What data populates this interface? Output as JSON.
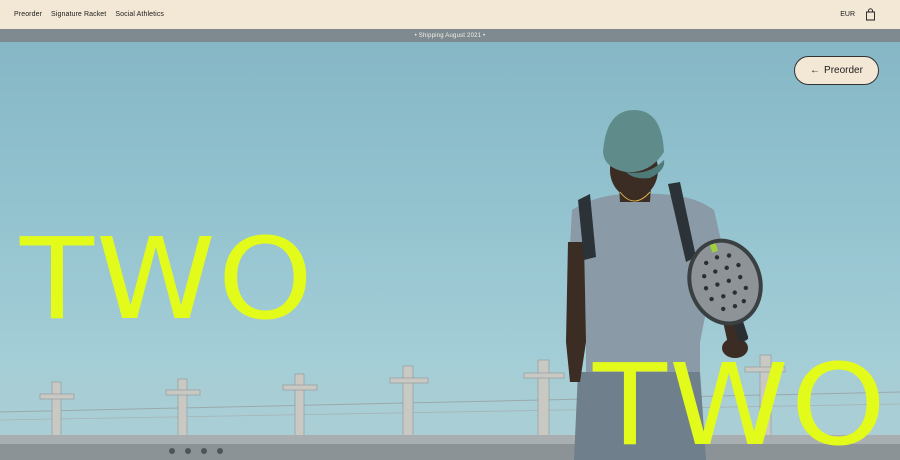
{
  "nav": {
    "items": [
      {
        "label": "Preorder"
      },
      {
        "label": "Signature Racket"
      },
      {
        "label": "Social Athletics"
      }
    ],
    "currency": "EUR",
    "bag_icon": "shopping-bag-icon"
  },
  "announcement": {
    "text": "• Shipping August 2021 •"
  },
  "hero": {
    "preorder_button": "Preorder",
    "arrow_icon": "arrow-left-icon",
    "headline_left": "TWO",
    "headline_right": "TWO"
  },
  "colors": {
    "cream": "#f3e8d6",
    "announce_bar": "#7e8a90",
    "sky": "#93c3cf",
    "neon": "#e3fb1a"
  }
}
